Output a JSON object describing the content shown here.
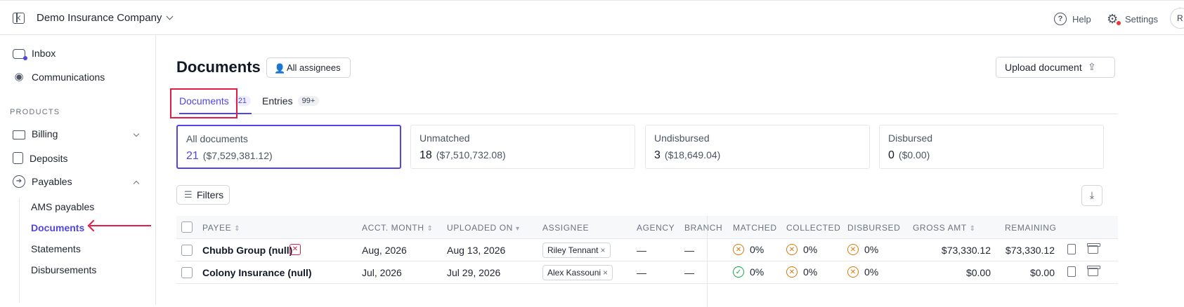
{
  "topbar": {
    "company": "Demo Insurance Company",
    "help": "Help",
    "settings": "Settings",
    "avatar": "R"
  },
  "sidebar": {
    "inbox": "Inbox",
    "communications": "Communications",
    "products_label": "PRODUCTS",
    "billing": "Billing",
    "deposits": "Deposits",
    "payables": "Payables",
    "sub": [
      "AMS payables",
      "Documents",
      "Statements",
      "Disbursements"
    ]
  },
  "main": {
    "title": "Documents",
    "assignees": "All assignees",
    "upload": "Upload document",
    "tabs": [
      {
        "label": "Documents",
        "count": "21"
      },
      {
        "label": "Entries",
        "count": "99+"
      }
    ],
    "cards": [
      {
        "label": "All documents",
        "count": "21",
        "amount": "($7,529,381.12)"
      },
      {
        "label": "Unmatched",
        "count": "18",
        "amount": "($7,510,732.08)"
      },
      {
        "label": "Undisbursed",
        "count": "3",
        "amount": "($18,649.04)"
      },
      {
        "label": "Disbursed",
        "count": "0",
        "amount": "($0.00)"
      }
    ],
    "filters": "Filters"
  },
  "table": {
    "headers": {
      "payee": "PAYEE",
      "acct_month": "ACCT. MONTH",
      "uploaded_on": "UPLOADED ON",
      "assignee": "ASSIGNEE",
      "agency": "AGENCY",
      "branch": "BRANCH",
      "matched": "MATCHED",
      "collected": "COLLECTED",
      "disbursed": "DISBURSED",
      "gross_amt": "GROSS AMT",
      "remaining": "REMAINING"
    },
    "rows": [
      {
        "payee": "Chubb Group (null)",
        "acct_month": "Aug, 2026",
        "uploaded_on": "Aug 13, 2026",
        "assignee": "Riley Tennant",
        "agency": "—",
        "branch": "—",
        "matched": "0%",
        "collected": "0%",
        "disbursed": "0%",
        "gross": "$73,330.12",
        "remaining": "$73,330.12"
      },
      {
        "payee": "Colony Insurance (null)",
        "acct_month": "Jul, 2026",
        "uploaded_on": "Jul 29, 2026",
        "assignee": "Alex Kassouni",
        "agency": "—",
        "branch": "—",
        "matched": "0%",
        "collected": "0%",
        "disbursed": "0%",
        "gross": "$0.00",
        "remaining": "$0.00"
      }
    ]
  },
  "colors": {
    "accent": "#4f46e5",
    "annotation": "#e11d48",
    "warning": "#d97706",
    "success": "#16a34a"
  }
}
